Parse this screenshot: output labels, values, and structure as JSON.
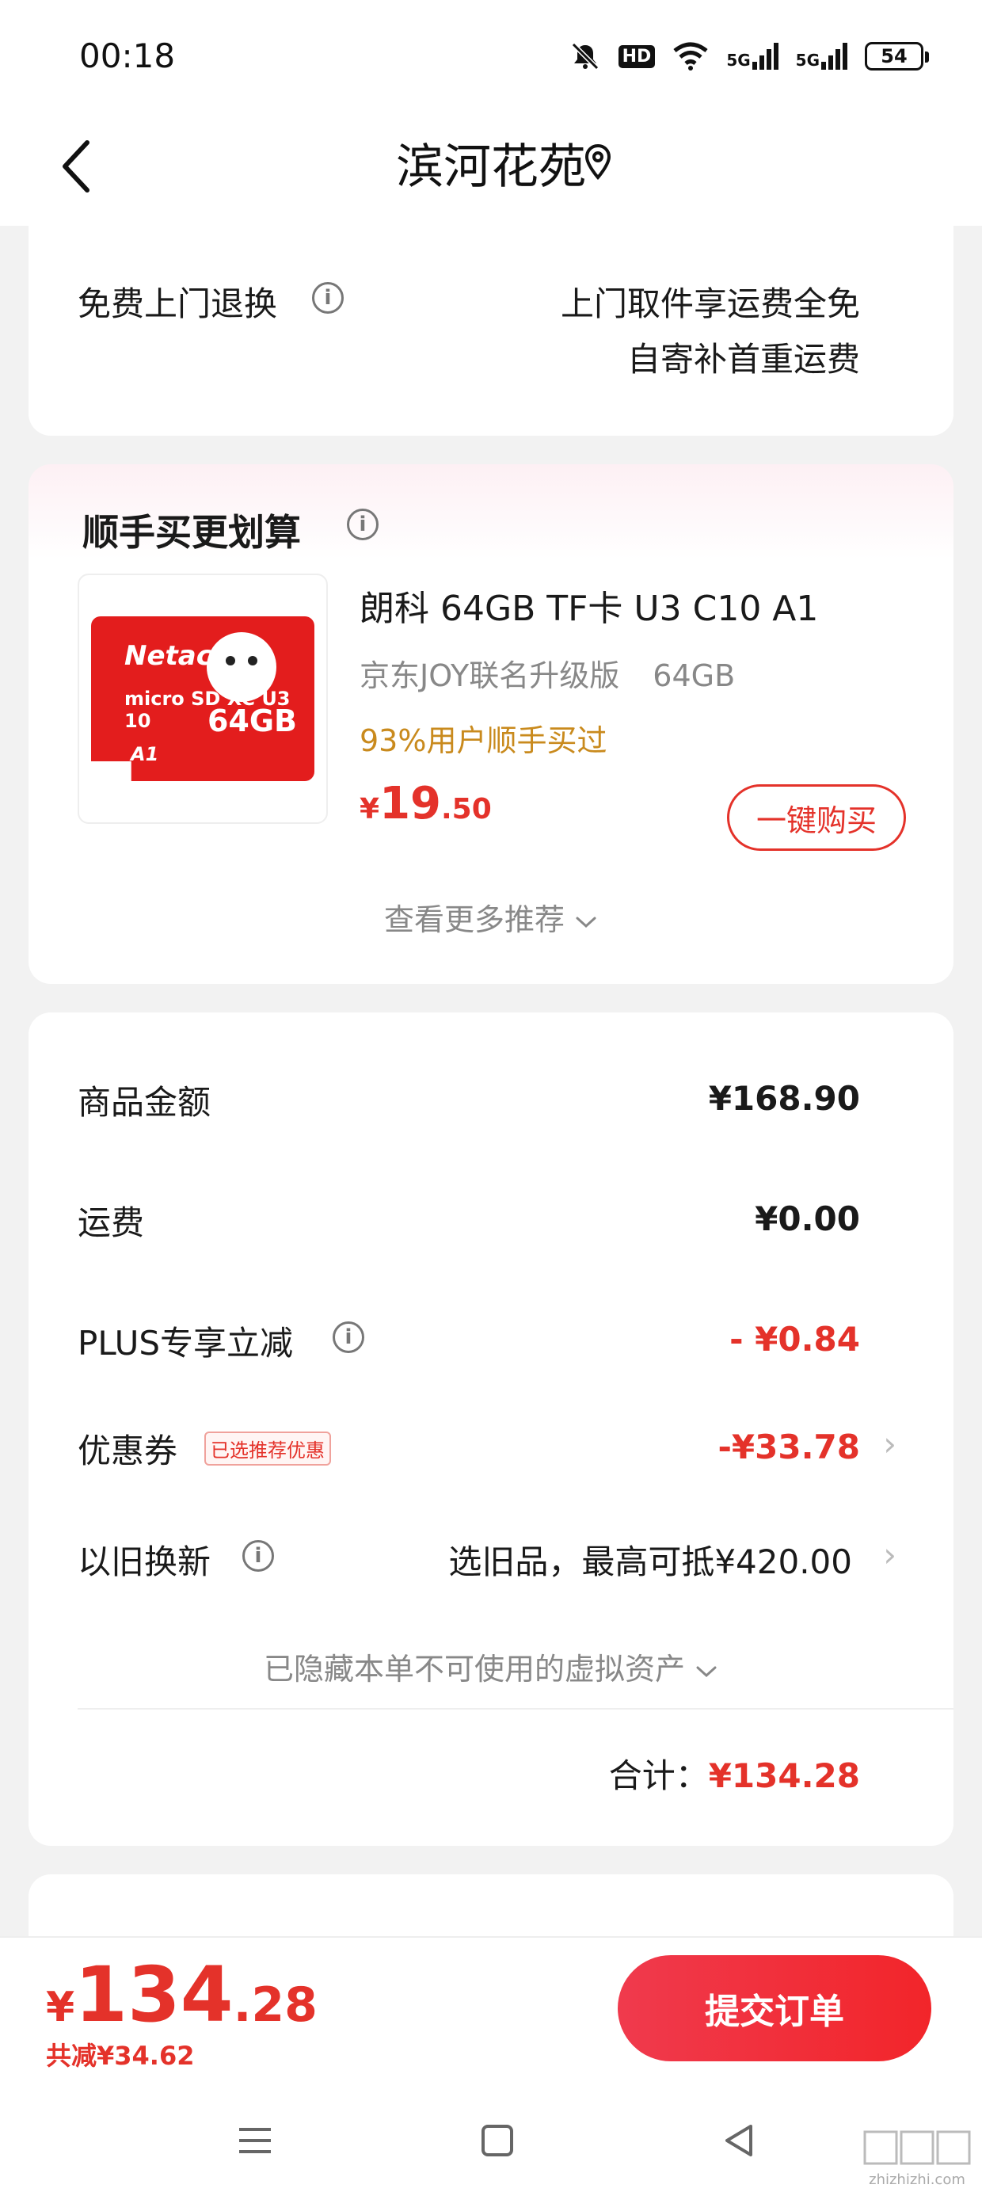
{
  "status_bar": {
    "time": "00:18",
    "hd_label": "HD",
    "net1": "5G",
    "net2": "5G",
    "battery": "54"
  },
  "header": {
    "title": "滨河花苑"
  },
  "return_policy": {
    "label": "免费上门退换",
    "line1": "上门取件享运费全免",
    "line2": "自寄补首重运费"
  },
  "recommend": {
    "title": "顺手买更划算",
    "product": {
      "name": "朗科 64GB TF卡 U3 C10 A1",
      "variant": "京东JOY联名升级版",
      "capacity": "64GB",
      "bought_hint": "93%用户顺手买过",
      "price_symbol": "¥",
      "price_int": "19",
      "price_dec": ".50",
      "buy_button": "一键购买",
      "thumb": {
        "brand": "Netac",
        "micro": "micro SD XC U3 10",
        "size": "64GB",
        "class": "A1"
      }
    },
    "more_label": "查看更多推荐"
  },
  "summary": {
    "goods_label": "商品金额",
    "goods_value": "¥168.90",
    "shipping_label": "运费",
    "shipping_value": "¥0.00",
    "plus_label": "PLUS专享立减",
    "plus_value": "- ¥0.84",
    "coupon_label": "优惠券",
    "coupon_tag": "已选推荐优惠",
    "coupon_value": "-¥33.78",
    "tradein_label": "以旧换新",
    "tradein_value": "选旧品，最高可抵¥420.00",
    "hidden_assets": "已隐藏本单不可使用的虚拟资产",
    "total_label": "合计：",
    "total_value": "¥134.28"
  },
  "bottom": {
    "price_symbol": "¥",
    "price_int": "134",
    "price_dec": ".28",
    "saving": "共减¥34.62",
    "submit": "提交订单"
  },
  "watermark": {
    "text": "zhizhizhi.com"
  },
  "colors": {
    "accent_red": "#e4322a",
    "gold": "#c98a1d",
    "muted": "#888888"
  }
}
